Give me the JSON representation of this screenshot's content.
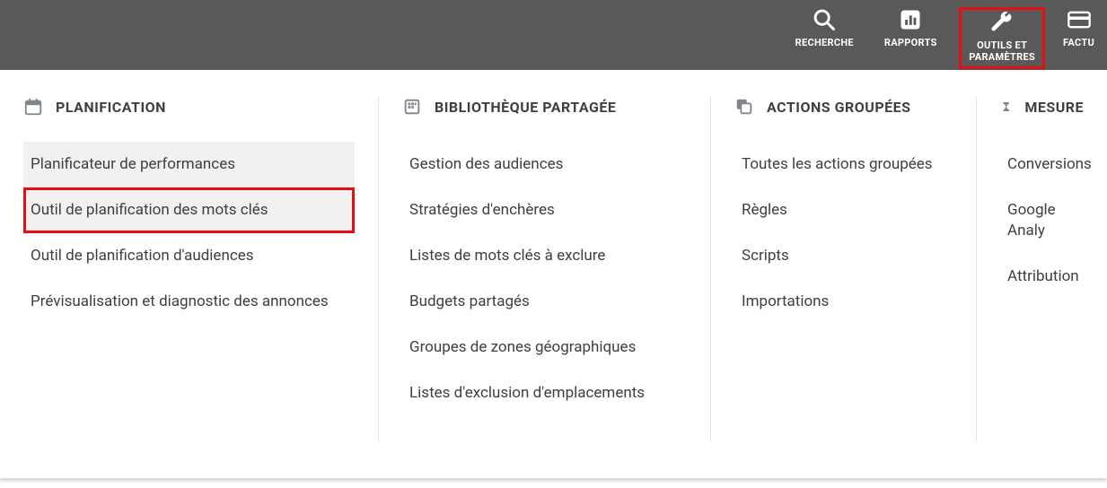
{
  "topbar": {
    "items": [
      {
        "label": "RECHERCHE",
        "icon": "search"
      },
      {
        "label": "RAPPORTS",
        "icon": "reports"
      },
      {
        "label": "OUTILS ET\nPARAMÈTRES",
        "icon": "wrench",
        "highlighted": true
      },
      {
        "label": "FACTU",
        "icon": "card"
      }
    ]
  },
  "columns": {
    "planning": {
      "title": "PLANIFICATION",
      "items": [
        "Planificateur de performances",
        "Outil de planification des mots clés",
        "Outil de planification d'audiences",
        "Prévisualisation et diagnostic des annonces"
      ]
    },
    "shared": {
      "title": "BIBLIOTHÈQUE PARTAGÉE",
      "items": [
        "Gestion des audiences",
        "Stratégies d'enchères",
        "Listes de mots clés à exclure",
        "Budgets partagés",
        "Groupes de zones géographiques",
        "Listes d'exclusion d'emplacements"
      ]
    },
    "bulk": {
      "title": "ACTIONS GROUPÉES",
      "items": [
        "Toutes les actions groupées",
        "Règles",
        "Scripts",
        "Importations"
      ]
    },
    "measure": {
      "title": "MESURE",
      "items": [
        "Conversions",
        "Google Analy",
        "Attribution"
      ]
    }
  }
}
